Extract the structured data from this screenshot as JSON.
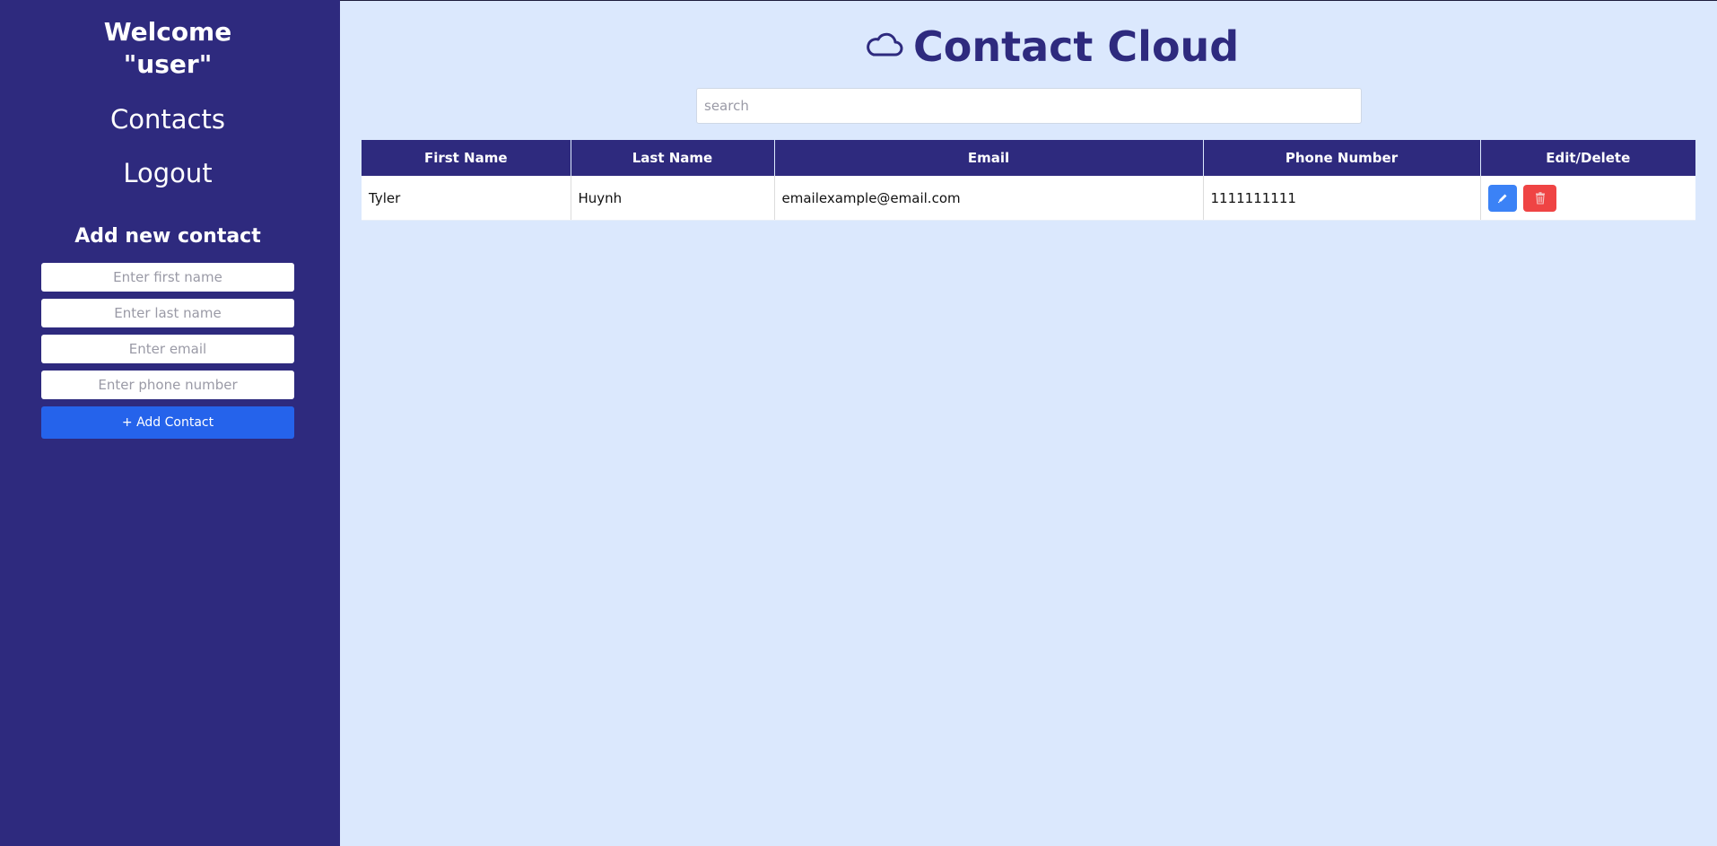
{
  "sidebar": {
    "welcome_line1": "Welcome",
    "welcome_line2": "\"user\"",
    "nav": {
      "contacts": "Contacts",
      "logout": "Logout"
    },
    "add_form": {
      "title": "Add new contact",
      "first_name_placeholder": "Enter first name",
      "last_name_placeholder": "Enter last name",
      "email_placeholder": "Enter email",
      "phone_placeholder": "Enter phone number",
      "submit_label": "+ Add Contact"
    }
  },
  "header": {
    "icon": "cloud-icon",
    "title": "Contact Cloud"
  },
  "search": {
    "placeholder": "search",
    "value": ""
  },
  "table": {
    "columns": [
      "First Name",
      "Last Name",
      "Email",
      "Phone Number",
      "Edit/Delete"
    ],
    "rows": [
      {
        "first_name": "Tyler",
        "last_name": "Huynh",
        "email": "emailexample@email.com",
        "phone": "1111111111",
        "actions": {
          "edit_icon": "pencil-icon",
          "delete_icon": "trash-icon"
        }
      }
    ]
  },
  "colors": {
    "sidebar_bg": "#2e2a7e",
    "page_bg": "#dbe8fd",
    "accent_blue": "#2563eb",
    "edit_blue": "#3b82f6",
    "delete_red": "#ef4444"
  }
}
